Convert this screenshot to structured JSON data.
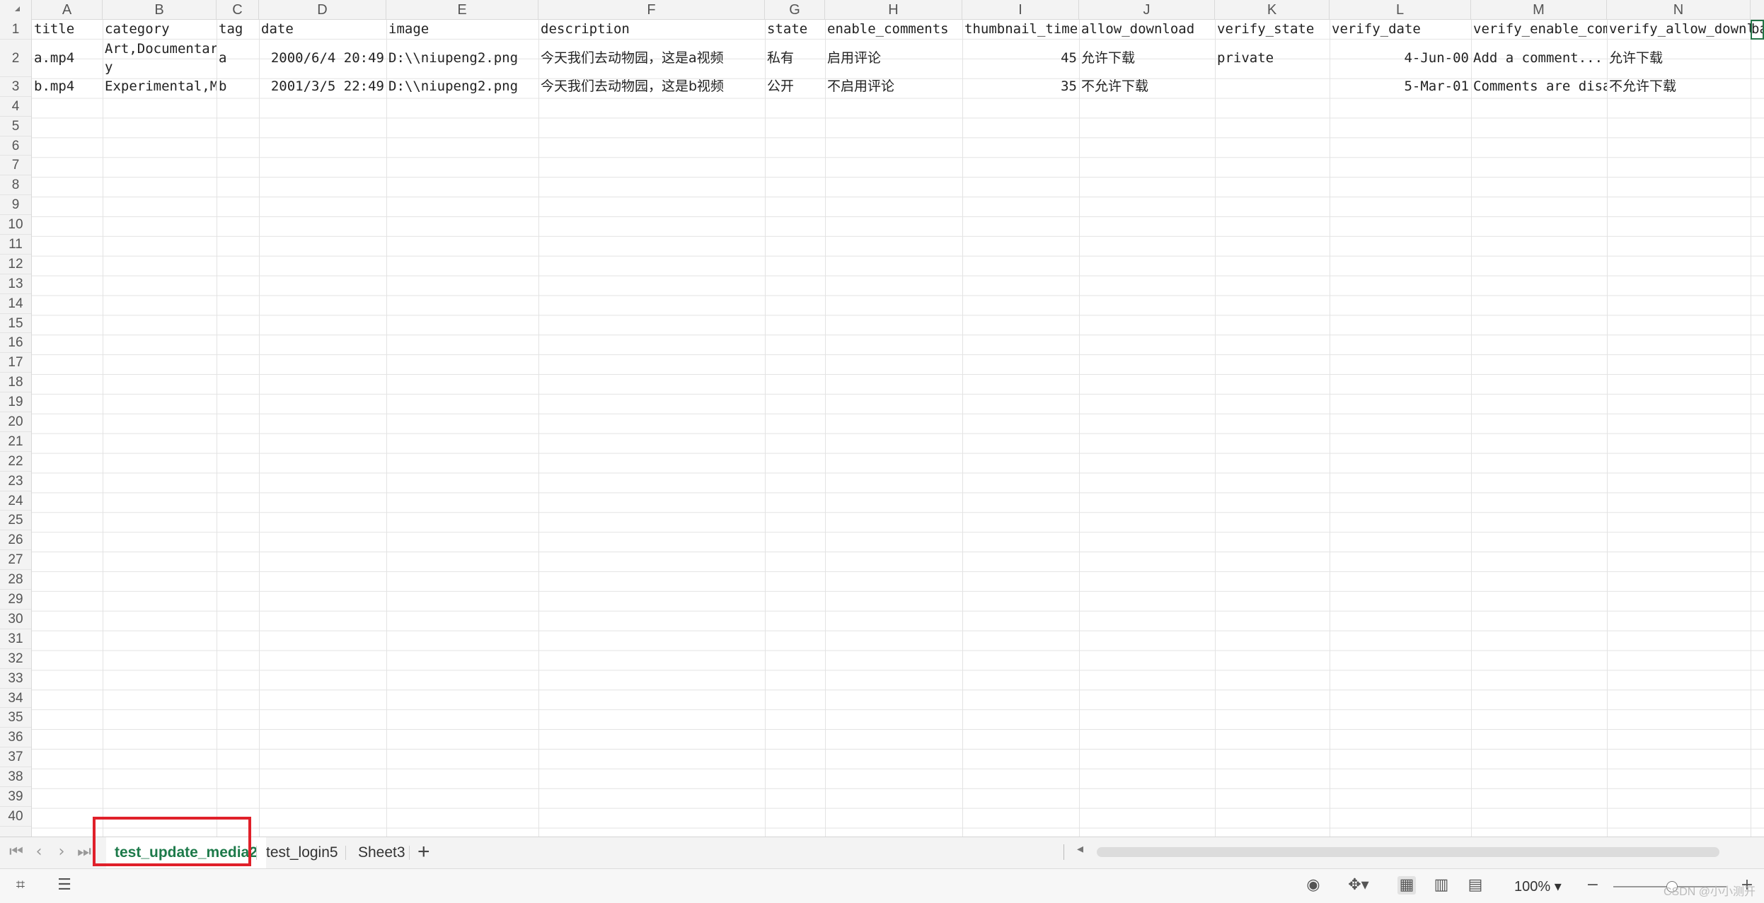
{
  "columns": [
    "A",
    "B",
    "C",
    "D",
    "E",
    "F",
    "G",
    "H",
    "I",
    "J",
    "K",
    "L",
    "M",
    "N"
  ],
  "rows": [
    "1",
    "2",
    "3",
    "4",
    "5",
    "6",
    "7",
    "8",
    "9",
    "10",
    "11",
    "12",
    "13",
    "14",
    "15",
    "16",
    "17",
    "18",
    "19",
    "20",
    "21",
    "22",
    "23",
    "24",
    "25",
    "26",
    "27",
    "28",
    "29",
    "30",
    "31",
    "32",
    "33",
    "34",
    "35",
    "36",
    "37",
    "38",
    "39",
    "40"
  ],
  "header_row": [
    "title",
    "category",
    "tag",
    "date",
    "image",
    "description",
    "state",
    "enable_comments",
    "thumbnail_time",
    "allow_download",
    "verify_state",
    "verify_date",
    "verify_enable_com",
    "verify_allow_downl",
    "ba"
  ],
  "row2": {
    "A": "a.mp4",
    "B_line1": "Art,Documentar",
    "B_line2": "y",
    "C": "a",
    "D": "2000/6/4 20:49",
    "E": "D:\\\\niupeng2.png",
    "F": "今天我们去动物园，这是a视频",
    "G": "私有",
    "H": "启用评论",
    "I": "45",
    "J": "允许下载",
    "K": "private",
    "L": "4-Jun-00",
    "M": "Add a comment...",
    "N": "允许下载"
  },
  "row3": {
    "A": "b.mp4",
    "B": "Experimental,Mu",
    "C": "b",
    "D": "2001/3/5 22:49",
    "E": "D:\\\\niupeng2.png",
    "F": "今天我们去动物园，这是b视频",
    "G": "公开",
    "H": "不启用评论",
    "I": "35",
    "J": "不允许下载",
    "K": "",
    "L": "5-Mar-01",
    "M": "Comments are disa",
    "N": "不允许下载"
  },
  "sheet_tabs": [
    "test_update_media2",
    "test_login5",
    "Sheet3"
  ],
  "active_tab": "test_update_media2",
  "zoom": "100%",
  "watermark": "CSDN @小小测开",
  "accent_color": "#217346",
  "highlight_color": "#e0202a",
  "icons": [
    "first-sheet-icon",
    "prev-sheet-icon",
    "next-sheet-icon",
    "last-sheet-icon",
    "add-sheet-icon",
    "eye-icon",
    "view-mode-icon",
    "normal-view-icon",
    "page-layout-icon",
    "page-break-icon",
    "zoom-out-icon",
    "zoom-in-icon"
  ]
}
